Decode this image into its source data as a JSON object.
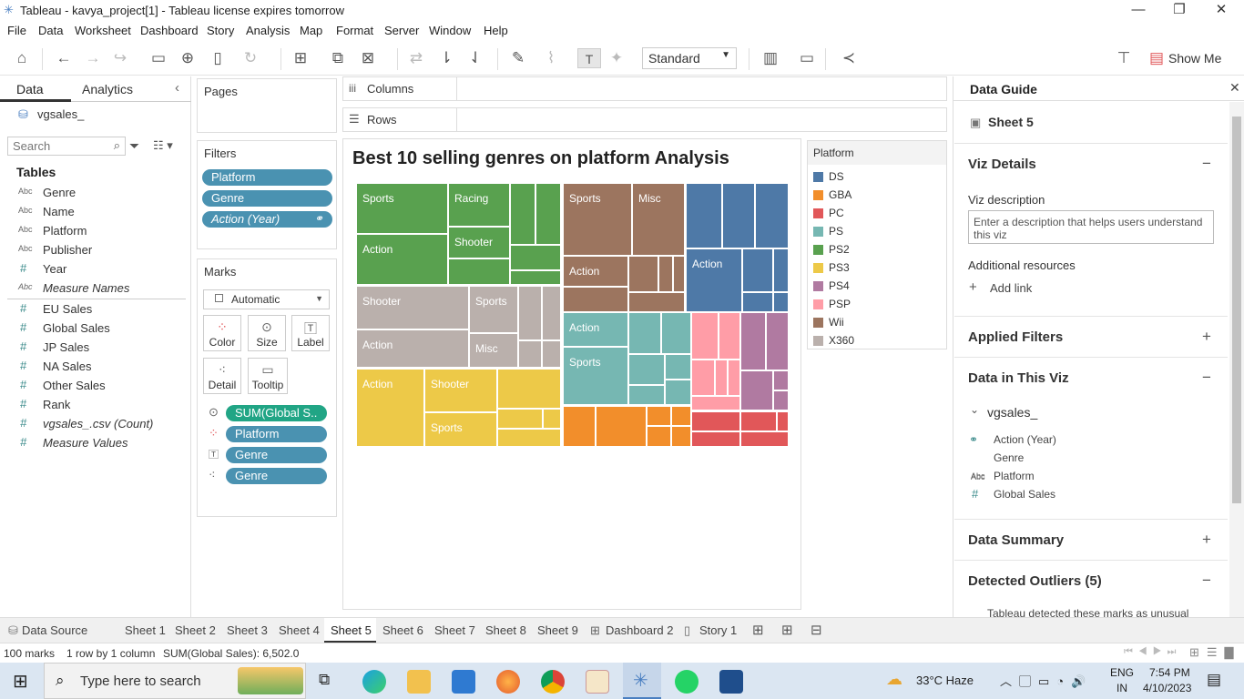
{
  "window": {
    "title": "Tableau - kavya_project[1] - Tableau license expires tomorrow",
    "minimize": "—",
    "restore": "❐",
    "close": "✕"
  },
  "menu": [
    "File",
    "Data",
    "Worksheet",
    "Dashboard",
    "Story",
    "Analysis",
    "Map",
    "Format",
    "Server",
    "Window",
    "Help"
  ],
  "toolbar": {
    "fit_select": "Standard",
    "show_me": "Show Me"
  },
  "left": {
    "tab_data": "Data",
    "tab_analytics": "Analytics",
    "datasource": "vgsales_",
    "search_placeholder": "Search",
    "tables_header": "Tables",
    "dims": [
      {
        "type": "Abc",
        "name": "Genre"
      },
      {
        "type": "Abc",
        "name": "Name"
      },
      {
        "type": "Abc",
        "name": "Platform"
      },
      {
        "type": "Abc",
        "name": "Publisher"
      },
      {
        "type": "#",
        "name": "Year"
      },
      {
        "type": "Abc",
        "name": "Measure Names"
      }
    ],
    "meas": [
      {
        "type": "#",
        "name": "EU Sales"
      },
      {
        "type": "#",
        "name": "Global Sales"
      },
      {
        "type": "#",
        "name": "JP Sales"
      },
      {
        "type": "#",
        "name": "NA Sales"
      },
      {
        "type": "#",
        "name": "Other Sales"
      },
      {
        "type": "#",
        "name": "Rank"
      },
      {
        "type": "#",
        "name": "vgsales_.csv (Count)"
      },
      {
        "type": "#",
        "name": "Measure Values"
      }
    ]
  },
  "pages_label": "Pages",
  "filters": {
    "label": "Filters",
    "items": [
      "Platform",
      "Genre",
      "Action (Year)"
    ]
  },
  "marks": {
    "label": "Marks",
    "type": "Automatic",
    "buttons": [
      "Color",
      "Size",
      "Label",
      "Detail",
      "Tooltip"
    ],
    "pills": [
      "SUM(Global S..",
      "Platform",
      "Genre",
      "Genre"
    ]
  },
  "shelves": {
    "columns": "Columns",
    "rows": "Rows"
  },
  "viz": {
    "title": "Best 10 selling genres on platform Analysis",
    "labels": {
      "ps2": [
        "Sports",
        "Racing",
        "Action",
        "Shooter"
      ],
      "wii": [
        "Sports",
        "Misc",
        "Action"
      ],
      "x360": [
        "Shooter",
        "Sports",
        "Action",
        "Misc"
      ],
      "ps3": [
        "Action",
        "Shooter",
        "Sports"
      ],
      "ps": [
        "Action",
        "Sports"
      ],
      "ds": [
        "Action"
      ]
    }
  },
  "legend": {
    "title": "Platform",
    "items": [
      {
        "name": "DS",
        "color": "#4e79a7"
      },
      {
        "name": "GBA",
        "color": "#f28e2b"
      },
      {
        "name": "PC",
        "color": "#e15759"
      },
      {
        "name": "PS",
        "color": "#76b7b2"
      },
      {
        "name": "PS2",
        "color": "#59a14f"
      },
      {
        "name": "PS3",
        "color": "#edc948"
      },
      {
        "name": "PS4",
        "color": "#b07aa1"
      },
      {
        "name": "PSP",
        "color": "#ff9da7"
      },
      {
        "name": "Wii",
        "color": "#9c755f"
      },
      {
        "name": "X360",
        "color": "#bab0ac"
      }
    ]
  },
  "guide": {
    "title": "Data Guide",
    "sheet": "Sheet 5",
    "viz_details": "Viz Details",
    "viz_description": "Viz description",
    "desc_placeholder": "Enter a description that helps users understand this viz",
    "additional": "Additional resources",
    "add_link": "Add link",
    "applied_filters": "Applied Filters",
    "data_in_viz": "Data in This Viz",
    "source": "vgsales_",
    "fields": [
      {
        "type": "⚭",
        "name": "Action (Year)"
      },
      {
        "type": "Abc",
        "name": "Genre"
      },
      {
        "type": "Abc",
        "name": "Platform"
      },
      {
        "type": "#",
        "name": "Global Sales"
      }
    ],
    "data_summary": "Data Summary",
    "outliers": "Detected Outliers (5)",
    "outliers_text": "Tableau detected these marks as unusual"
  },
  "sheet_tabs": [
    "Data Source",
    "Sheet 1",
    "Sheet 2",
    "Sheet 3",
    "Sheet 4",
    "Sheet 5",
    "Sheet 6",
    "Sheet 7",
    "Sheet 8",
    "Sheet 9",
    "Dashboard 2",
    "Story 1"
  ],
  "status": {
    "marks": "100 marks",
    "rows": "1 row by 1 column",
    "sum": "SUM(Global Sales): 6,502.0"
  },
  "taskbar": {
    "search": "Type here to search",
    "weather": "33°C  Haze",
    "lang1": "ENG",
    "lang2": "IN",
    "time": "7:54 PM",
    "date": "4/10/2023"
  }
}
